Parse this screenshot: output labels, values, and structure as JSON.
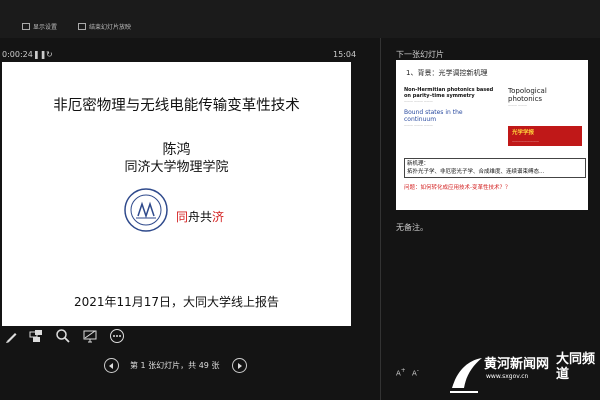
{
  "toolbar": {
    "display_settings": "显示设置",
    "end_show": "结束幻灯片放映"
  },
  "presenter": {
    "timer": "0:00:24",
    "clock": "15:04",
    "next_slide_label": "下一张幻灯片",
    "notes": "无备注。",
    "slide_counter": "第 1 张幻灯片，共 49 张"
  },
  "current_slide": {
    "title": "非厄密物理与无线电能传输变革性技术",
    "presenter": "陈鸿",
    "affiliation": "同济大学物理学院",
    "motto_red": "同",
    "motto_mid": "舟共",
    "motto_red2": "济",
    "date_line": "2021年11月17日，大同大学线上报告"
  },
  "next_slide": {
    "title": "1、背景：光学调控新机理",
    "paper1_title": "Non-Hermitian photonics based on parity–time symmetry",
    "paper2_title": "Bound states in the continuum",
    "paper3_title": "Topological photonics",
    "journal_badge": "光学学报",
    "mechanism_heading": "新机理：",
    "mechanism_text": "拓扑光子学、非厄密光子学、合成维度、连续谱束缚态…",
    "question": "问题：如何转化成应用技术-变革性技术？？"
  },
  "watermark": {
    "site": "黄河新闻网",
    "url": "www.sxgov.cn",
    "channel": "大同频道"
  },
  "colors": {
    "background": "#141414",
    "accent_red": "#d42020"
  }
}
